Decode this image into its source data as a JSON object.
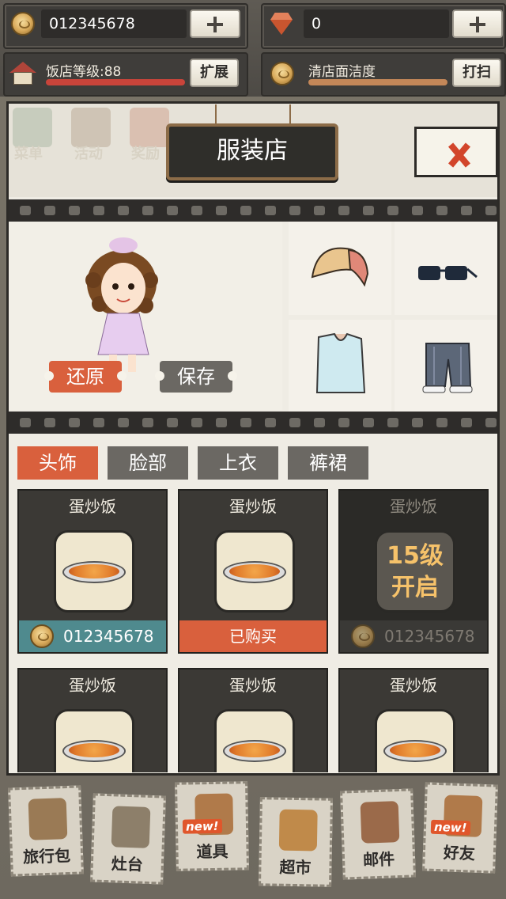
{
  "top": {
    "coins": "012345678",
    "gems": "0",
    "restaurant_level_label": "饭店等级:88",
    "expand_label": "扩展",
    "cleanliness_label": "清店面洁度",
    "clean_label": "打扫"
  },
  "header": {
    "title": "服装店",
    "faded_tabs": [
      "菜单",
      "活动",
      "奖励"
    ]
  },
  "preview": {
    "restore_label": "还原",
    "save_label": "保存"
  },
  "slots": [
    "hat-icon",
    "sunglasses-icon",
    "top-shirt-icon",
    "pants-icon"
  ],
  "tabs": [
    {
      "label": "头饰",
      "active": true
    },
    {
      "label": "脸部",
      "active": false
    },
    {
      "label": "上衣",
      "active": false
    },
    {
      "label": "裤裙",
      "active": false
    }
  ],
  "items": [
    {
      "name": "蛋炒饭",
      "state": "price",
      "price": "012345678"
    },
    {
      "name": "蛋炒饭",
      "state": "bought",
      "status": "已购买"
    },
    {
      "name": "蛋炒饭",
      "state": "locked",
      "lock_text": "15级 开启",
      "price": "012345678"
    },
    {
      "name": "蛋炒饭",
      "state": "partial"
    },
    {
      "name": "蛋炒饭",
      "state": "partial"
    },
    {
      "name": "蛋炒饭",
      "state": "partial"
    }
  ],
  "nav": [
    {
      "label": "旅行包",
      "icon": "backpack-icon"
    },
    {
      "label": "灶台",
      "icon": "stove-icon"
    },
    {
      "label": "道具",
      "icon": "monkey-props-icon",
      "badge": "new!"
    },
    {
      "label": "超市",
      "icon": "grocery-basket-icon"
    },
    {
      "label": "邮件",
      "icon": "mailbox-icon"
    },
    {
      "label": "好友",
      "icon": "friends-icon",
      "badge": "new!"
    }
  ],
  "colors": {
    "accent": "#d9603d",
    "tab_inactive": "#6b6863",
    "price_bar": "#4f8a8e",
    "bought_bar": "#d9603d",
    "level_bar": "#c9443a",
    "clean_bar": "#c48758"
  }
}
